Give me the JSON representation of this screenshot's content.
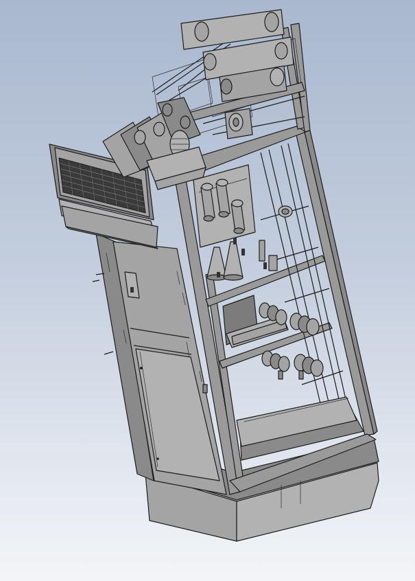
{
  "viewport": {
    "background_top": "#a9b8cf",
    "background_bottom": "#f3f5f8",
    "model_color": "#a0a0a0",
    "edge_color": "#1c1c1c"
  },
  "model": {
    "icon": "switchgear-cabinet-model"
  }
}
